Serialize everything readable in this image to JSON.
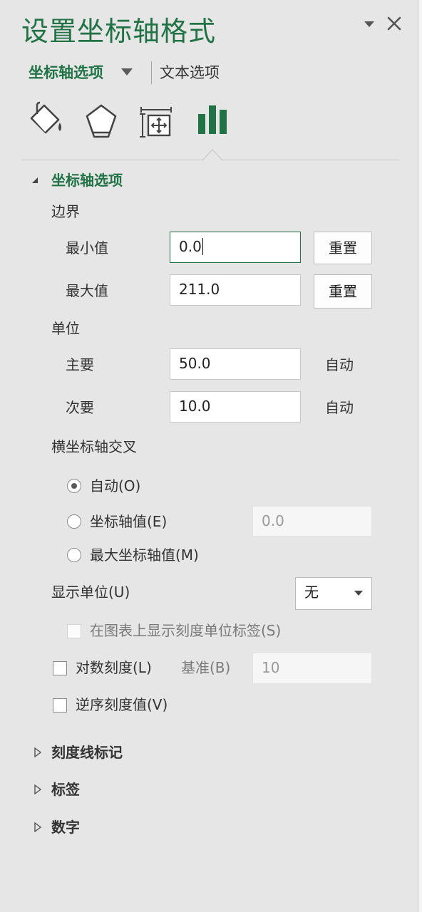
{
  "pane": {
    "title": "设置坐标轴格式",
    "tabs": {
      "axis_options": "坐标轴选项",
      "text_options": "文本选项"
    },
    "icons": [
      "fill-line-icon",
      "effects-icon",
      "size-properties-icon",
      "axis-options-icon"
    ]
  },
  "section": {
    "title": "坐标轴选项",
    "bounds": {
      "label": "边界",
      "min_label": "最小值",
      "min_value": "0.0",
      "max_label": "最大值",
      "max_value": "211.0",
      "reset_label": "重置"
    },
    "units": {
      "label": "单位",
      "major_label": "主要",
      "major_value": "50.0",
      "minor_label": "次要",
      "minor_value": "10.0",
      "auto_label": "自动"
    },
    "cross": {
      "label": "横坐标轴交叉",
      "auto": "自动(O)",
      "axis_value": "坐标轴值(E)",
      "axis_value_input": "0.0",
      "max_axis_value": "最大坐标轴值(M)",
      "selected": "auto"
    },
    "display_units": {
      "label": "显示单位(U)",
      "value": "无",
      "show_label": "在图表上显示刻度单位标签(S)"
    },
    "log_scale": {
      "label": "对数刻度(L)",
      "base_label": "基准(B)",
      "base_value": "10"
    },
    "reverse": {
      "label": "逆序刻度值(V)"
    }
  },
  "collapsed_sections": [
    "刻度线标记",
    "标签",
    "数字"
  ],
  "colors": {
    "accent": "#217346",
    "pane_bg": "#e6e6e6"
  }
}
